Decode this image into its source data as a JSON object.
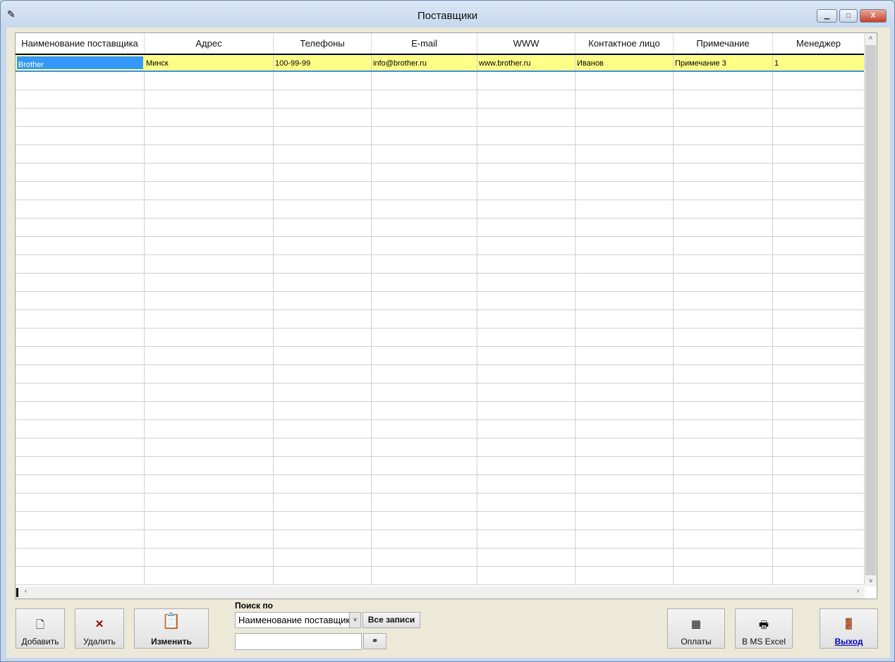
{
  "window": {
    "title": "Поставщики",
    "minimize": "▁",
    "maximize": "□",
    "close": "X"
  },
  "table": {
    "columns": [
      "Наименование поставщика",
      "Адрес",
      "Телефоны",
      "E-mail",
      "WWW",
      "Контактное лицо",
      "Примечание",
      "Менеджер"
    ],
    "rows": [
      [
        "Brother",
        "Минск",
        "100-99-99",
        "info@brother.ru",
        "www.brother.ru",
        "Иванов",
        "Примечание 3",
        "1"
      ]
    ]
  },
  "buttons": {
    "add": "Добавить",
    "delete": "Удалить",
    "edit": "Изменить",
    "all_records": "Все записи",
    "payments": "Оплаты",
    "excel": "В MS Excel",
    "exit": "Выход"
  },
  "search": {
    "label": "Поиск по",
    "field": "Наименование поставщика",
    "value": ""
  }
}
